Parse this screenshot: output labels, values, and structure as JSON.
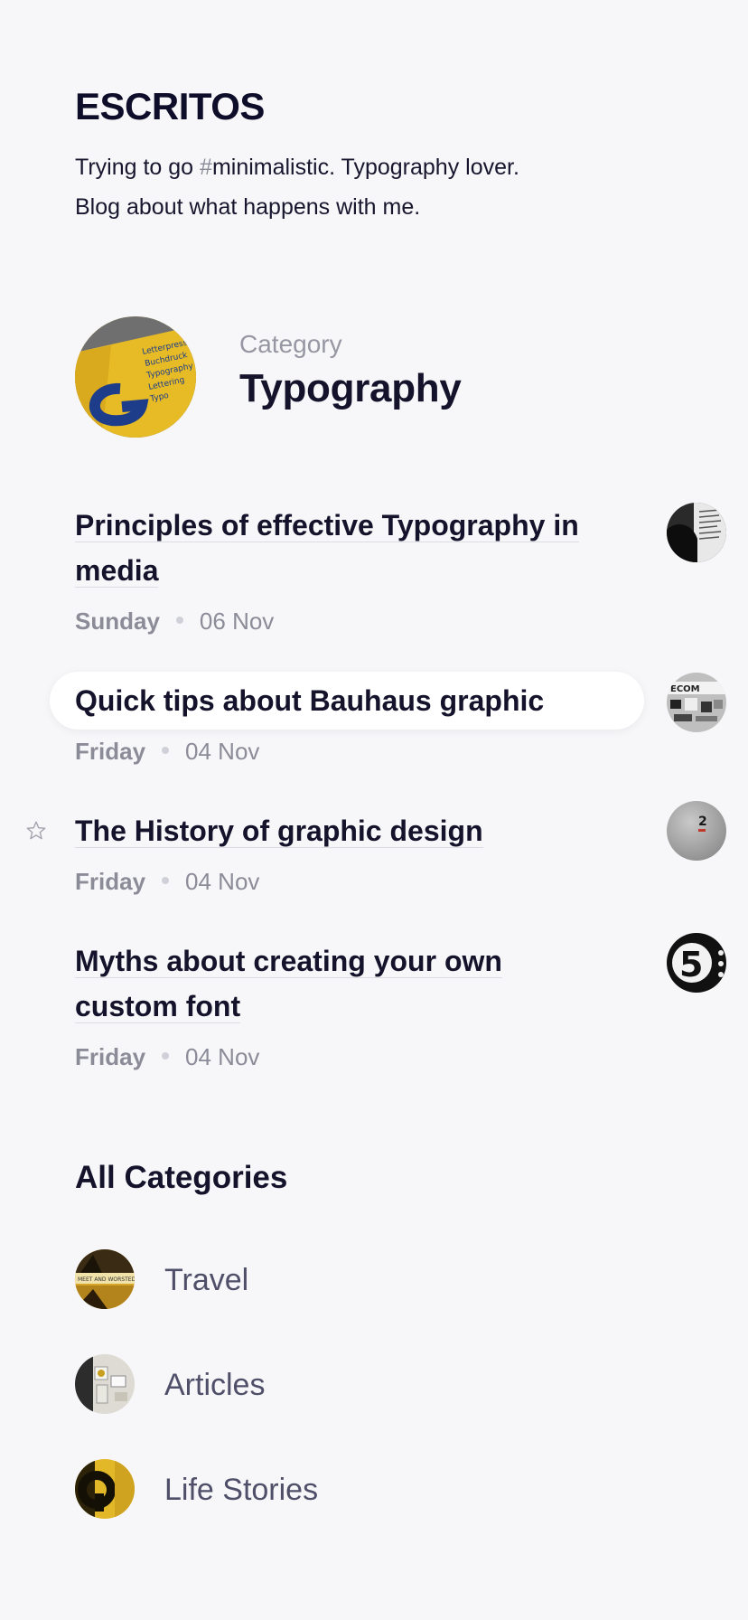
{
  "header": {
    "brand": "ESCRITOS",
    "bio_line1_pre": "Trying to go ",
    "bio_hash": "#",
    "bio_line1_post": "minimalistic. Typography lover.",
    "bio_line2": "Blog about what happens with me."
  },
  "category": {
    "label": "Category",
    "title": "Typography",
    "avatar_icon": "typography-photo"
  },
  "posts": [
    {
      "title": "Principles of effective Typography in media",
      "day": "Sunday",
      "date": "06 Nov",
      "thumb": "dark-book-photo",
      "starred": false,
      "highlighted": false
    },
    {
      "title": "Quick tips about Bauhaus graphic",
      "day": "Friday",
      "date": "04 Nov",
      "thumb": "bauhaus-poster-photo",
      "starred": false,
      "highlighted": true
    },
    {
      "title": "The History of graphic design",
      "day": "Friday",
      "date": "04 Nov",
      "thumb": "number-two-photo",
      "starred": true,
      "highlighted": false
    },
    {
      "title": "Myths about creating your own custom font",
      "day": "Friday",
      "date": "04 Nov",
      "thumb": "number-five-photo",
      "starred": false,
      "highlighted": false
    }
  ],
  "all_categories": {
    "title": "All Categories",
    "items": [
      {
        "name": "Travel",
        "icon": "travel-photo"
      },
      {
        "name": "Articles",
        "icon": "articles-photo"
      },
      {
        "name": "Life Stories",
        "icon": "life-stories-photo"
      }
    ]
  },
  "colors": {
    "background": "#f7f7f9",
    "text_primary": "#14132b",
    "text_muted": "#8c8c99",
    "accent_yellow": "#e8be2a"
  }
}
